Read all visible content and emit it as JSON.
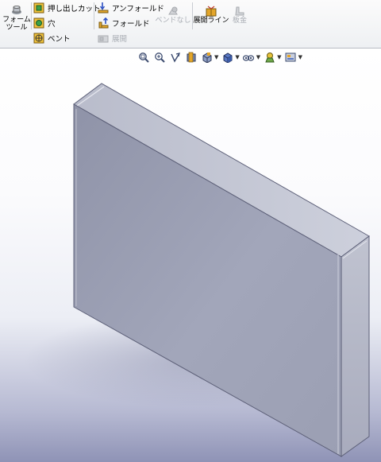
{
  "toolbar": {
    "form_tool_label_1": "フォーム",
    "form_tool_label_2": "ツール",
    "extruded_cut_label": "押し出しカット",
    "hole_label": "穴",
    "vent_label": "ベント",
    "unfold_label": "アンフォールド",
    "fold_label": "フォールド",
    "flatten_label": "展開",
    "no_bends_label": "ベンドなし",
    "flat_pattern_label": "展開ライン",
    "sheet_metal_label": "板金"
  },
  "heads_up_toolbar": {
    "icons": [
      "zoom-to-fit-icon",
      "zoom-area-icon",
      "previous-view-icon",
      "section-view-icon",
      "view-orientation-icon",
      "display-style-icon",
      "hide-show-items-icon",
      "edit-appearance-icon",
      "apply-scene-icon"
    ]
  },
  "colors": {
    "face_front": "#9da1b4",
    "face_top": "#c3c6d4",
    "face_side": "#b2b5c5",
    "accent_orange": "#e3a52a"
  }
}
